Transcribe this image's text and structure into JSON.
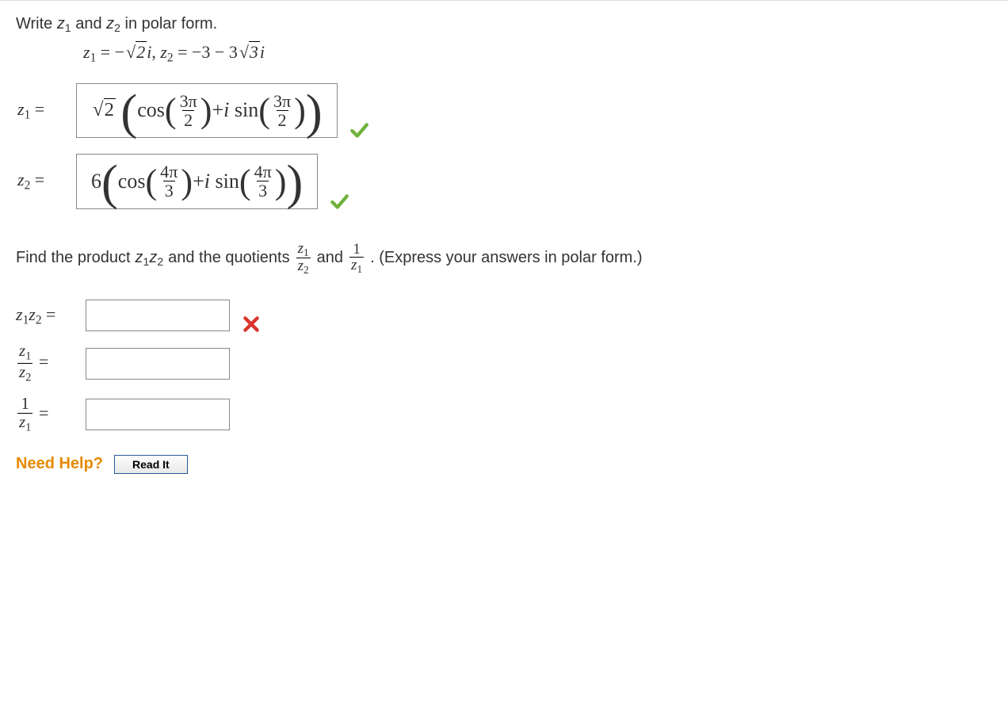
{
  "prompt1_pre": "Write ",
  "prompt1_z1": "z",
  "prompt1_z1_sub": "1",
  "prompt1_mid1": " and ",
  "prompt1_z2": "z",
  "prompt1_z2_sub": "2",
  "prompt1_post": " in polar form.",
  "given": {
    "z1_var": "z",
    "z1_sub": "1",
    "eq": " = ",
    "neg": "−",
    "sqrt2": "2",
    "i": "i",
    "comma": ",  ",
    "z2_var": "z",
    "z2_sub": "2",
    "rhs2_a": "−3 − 3",
    "sqrt3": "3",
    "rhs2_b": "i"
  },
  "row1": {
    "label_var": "z",
    "label_sub": "1",
    "label_eq": " = ",
    "coef_sqrt": "2",
    "cos": "cos",
    "sin": "sin",
    "plus_i": " + ",
    "i": "i",
    "frac_num": "3π",
    "frac_den": "2"
  },
  "row2": {
    "label_var": "z",
    "label_sub": "2",
    "label_eq": " = ",
    "coef": "6",
    "cos": "cos",
    "sin": "sin",
    "plus_i": " + ",
    "i": "i",
    "frac_num": "4π",
    "frac_den": "3"
  },
  "prompt2": {
    "a": "Find the product ",
    "z1z2_z": "z",
    "z1z2_s1": "1",
    "z1z2_s2": "2",
    "b": " and the quotients ",
    "f1_num_v": "z",
    "f1_num_s": "1",
    "f1_den_v": "z",
    "f1_den_s": "2",
    "and": " and ",
    "f2_num": "1",
    "f2_den_v": "z",
    "f2_den_s": "1",
    "c": ".  (Express your answers in polar form.)"
  },
  "blank1": {
    "v": "z",
    "s1": "1",
    "s2": "2",
    "eq": " = "
  },
  "blank2": {
    "num_v": "z",
    "num_s": "1",
    "den_v": "z",
    "den_s": "2",
    "eq": " = "
  },
  "blank3": {
    "num": "1",
    "den_v": "z",
    "den_s": "1",
    "eq": " = "
  },
  "help_label": "Need Help?",
  "read_it": "Read It"
}
